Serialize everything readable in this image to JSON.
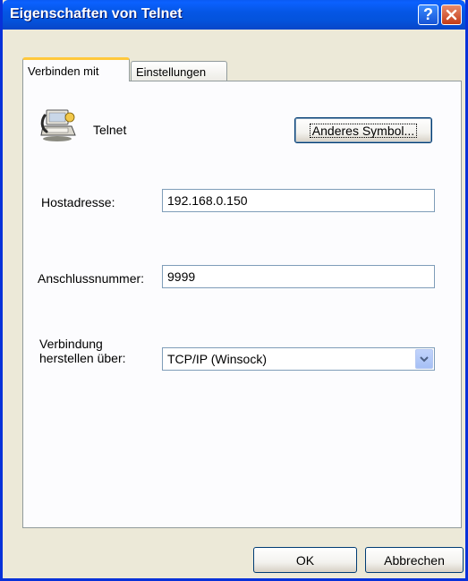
{
  "window": {
    "title": "Eigenschaften von Telnet"
  },
  "tabs": [
    {
      "label": "Verbinden mit",
      "active": true
    },
    {
      "label": "Einstellungen",
      "active": false
    }
  ],
  "connection": {
    "name": "Telnet",
    "icon": "telephone-computer-icon",
    "change_icon_button": "Anderes Symbol..."
  },
  "fields": {
    "host_label": "Hostadresse:",
    "host_value": "192.168.0.150",
    "port_label": "Anschlussnummer:",
    "port_value": "9999",
    "connect_via_label_line1": "Verbindung",
    "connect_via_label_line2": "herstellen über:",
    "connect_via_value": "TCP/IP (Winsock)"
  },
  "buttons": {
    "ok": "OK",
    "cancel": "Abbrechen"
  },
  "colors": {
    "titlebar": "#0453dc",
    "dialog_bg": "#ece9d8",
    "panel_bg": "#fcfcfe",
    "tab_accent": "#ffc83c",
    "close_button": "#c43b17"
  }
}
